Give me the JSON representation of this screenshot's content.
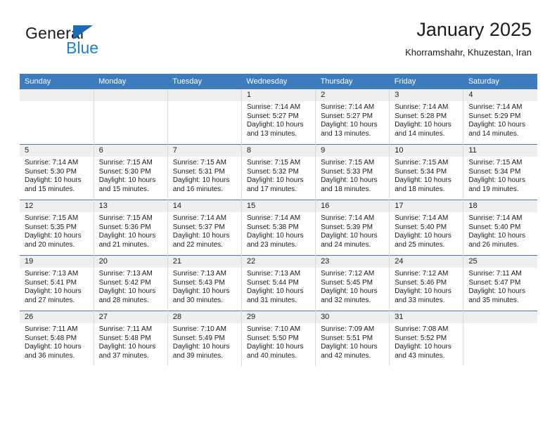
{
  "brand": {
    "name_part1": "General",
    "name_part2": "Blue",
    "triangle_color": "#1b6cb5",
    "blue_color": "#1b7fd4"
  },
  "header": {
    "title": "January 2025",
    "subtitle": "Khorramshahr, Khuzestan, Iran",
    "header_bg": "#3d7cbf",
    "daynum_bg": "#efefef"
  },
  "weekday_headers": [
    "Sunday",
    "Monday",
    "Tuesday",
    "Wednesday",
    "Thursday",
    "Friday",
    "Saturday"
  ],
  "labels": {
    "sunrise_prefix": "Sunrise:",
    "sunset_prefix": "Sunset:",
    "daylight_prefix": "Daylight:"
  },
  "weeks": [
    [
      {
        "empty": true
      },
      {
        "empty": true
      },
      {
        "empty": true
      },
      {
        "day": "1",
        "sunrise": "Sunrise: 7:14 AM",
        "sunset": "Sunset: 5:27 PM",
        "daylight_line1": "Daylight: 10 hours",
        "daylight_line2": "and 13 minutes."
      },
      {
        "day": "2",
        "sunrise": "Sunrise: 7:14 AM",
        "sunset": "Sunset: 5:27 PM",
        "daylight_line1": "Daylight: 10 hours",
        "daylight_line2": "and 13 minutes."
      },
      {
        "day": "3",
        "sunrise": "Sunrise: 7:14 AM",
        "sunset": "Sunset: 5:28 PM",
        "daylight_line1": "Daylight: 10 hours",
        "daylight_line2": "and 14 minutes."
      },
      {
        "day": "4",
        "sunrise": "Sunrise: 7:14 AM",
        "sunset": "Sunset: 5:29 PM",
        "daylight_line1": "Daylight: 10 hours",
        "daylight_line2": "and 14 minutes."
      }
    ],
    [
      {
        "day": "5",
        "sunrise": "Sunrise: 7:14 AM",
        "sunset": "Sunset: 5:30 PM",
        "daylight_line1": "Daylight: 10 hours",
        "daylight_line2": "and 15 minutes."
      },
      {
        "day": "6",
        "sunrise": "Sunrise: 7:15 AM",
        "sunset": "Sunset: 5:30 PM",
        "daylight_line1": "Daylight: 10 hours",
        "daylight_line2": "and 15 minutes."
      },
      {
        "day": "7",
        "sunrise": "Sunrise: 7:15 AM",
        "sunset": "Sunset: 5:31 PM",
        "daylight_line1": "Daylight: 10 hours",
        "daylight_line2": "and 16 minutes."
      },
      {
        "day": "8",
        "sunrise": "Sunrise: 7:15 AM",
        "sunset": "Sunset: 5:32 PM",
        "daylight_line1": "Daylight: 10 hours",
        "daylight_line2": "and 17 minutes."
      },
      {
        "day": "9",
        "sunrise": "Sunrise: 7:15 AM",
        "sunset": "Sunset: 5:33 PM",
        "daylight_line1": "Daylight: 10 hours",
        "daylight_line2": "and 18 minutes."
      },
      {
        "day": "10",
        "sunrise": "Sunrise: 7:15 AM",
        "sunset": "Sunset: 5:34 PM",
        "daylight_line1": "Daylight: 10 hours",
        "daylight_line2": "and 18 minutes."
      },
      {
        "day": "11",
        "sunrise": "Sunrise: 7:15 AM",
        "sunset": "Sunset: 5:34 PM",
        "daylight_line1": "Daylight: 10 hours",
        "daylight_line2": "and 19 minutes."
      }
    ],
    [
      {
        "day": "12",
        "sunrise": "Sunrise: 7:15 AM",
        "sunset": "Sunset: 5:35 PM",
        "daylight_line1": "Daylight: 10 hours",
        "daylight_line2": "and 20 minutes."
      },
      {
        "day": "13",
        "sunrise": "Sunrise: 7:15 AM",
        "sunset": "Sunset: 5:36 PM",
        "daylight_line1": "Daylight: 10 hours",
        "daylight_line2": "and 21 minutes."
      },
      {
        "day": "14",
        "sunrise": "Sunrise: 7:14 AM",
        "sunset": "Sunset: 5:37 PM",
        "daylight_line1": "Daylight: 10 hours",
        "daylight_line2": "and 22 minutes."
      },
      {
        "day": "15",
        "sunrise": "Sunrise: 7:14 AM",
        "sunset": "Sunset: 5:38 PM",
        "daylight_line1": "Daylight: 10 hours",
        "daylight_line2": "and 23 minutes."
      },
      {
        "day": "16",
        "sunrise": "Sunrise: 7:14 AM",
        "sunset": "Sunset: 5:39 PM",
        "daylight_line1": "Daylight: 10 hours",
        "daylight_line2": "and 24 minutes."
      },
      {
        "day": "17",
        "sunrise": "Sunrise: 7:14 AM",
        "sunset": "Sunset: 5:40 PM",
        "daylight_line1": "Daylight: 10 hours",
        "daylight_line2": "and 25 minutes."
      },
      {
        "day": "18",
        "sunrise": "Sunrise: 7:14 AM",
        "sunset": "Sunset: 5:40 PM",
        "daylight_line1": "Daylight: 10 hours",
        "daylight_line2": "and 26 minutes."
      }
    ],
    [
      {
        "day": "19",
        "sunrise": "Sunrise: 7:13 AM",
        "sunset": "Sunset: 5:41 PM",
        "daylight_line1": "Daylight: 10 hours",
        "daylight_line2": "and 27 minutes."
      },
      {
        "day": "20",
        "sunrise": "Sunrise: 7:13 AM",
        "sunset": "Sunset: 5:42 PM",
        "daylight_line1": "Daylight: 10 hours",
        "daylight_line2": "and 28 minutes."
      },
      {
        "day": "21",
        "sunrise": "Sunrise: 7:13 AM",
        "sunset": "Sunset: 5:43 PM",
        "daylight_line1": "Daylight: 10 hours",
        "daylight_line2": "and 30 minutes."
      },
      {
        "day": "22",
        "sunrise": "Sunrise: 7:13 AM",
        "sunset": "Sunset: 5:44 PM",
        "daylight_line1": "Daylight: 10 hours",
        "daylight_line2": "and 31 minutes."
      },
      {
        "day": "23",
        "sunrise": "Sunrise: 7:12 AM",
        "sunset": "Sunset: 5:45 PM",
        "daylight_line1": "Daylight: 10 hours",
        "daylight_line2": "and 32 minutes."
      },
      {
        "day": "24",
        "sunrise": "Sunrise: 7:12 AM",
        "sunset": "Sunset: 5:46 PM",
        "daylight_line1": "Daylight: 10 hours",
        "daylight_line2": "and 33 minutes."
      },
      {
        "day": "25",
        "sunrise": "Sunrise: 7:11 AM",
        "sunset": "Sunset: 5:47 PM",
        "daylight_line1": "Daylight: 10 hours",
        "daylight_line2": "and 35 minutes."
      }
    ],
    [
      {
        "day": "26",
        "sunrise": "Sunrise: 7:11 AM",
        "sunset": "Sunset: 5:48 PM",
        "daylight_line1": "Daylight: 10 hours",
        "daylight_line2": "and 36 minutes."
      },
      {
        "day": "27",
        "sunrise": "Sunrise: 7:11 AM",
        "sunset": "Sunset: 5:48 PM",
        "daylight_line1": "Daylight: 10 hours",
        "daylight_line2": "and 37 minutes."
      },
      {
        "day": "28",
        "sunrise": "Sunrise: 7:10 AM",
        "sunset": "Sunset: 5:49 PM",
        "daylight_line1": "Daylight: 10 hours",
        "daylight_line2": "and 39 minutes."
      },
      {
        "day": "29",
        "sunrise": "Sunrise: 7:10 AM",
        "sunset": "Sunset: 5:50 PM",
        "daylight_line1": "Daylight: 10 hours",
        "daylight_line2": "and 40 minutes."
      },
      {
        "day": "30",
        "sunrise": "Sunrise: 7:09 AM",
        "sunset": "Sunset: 5:51 PM",
        "daylight_line1": "Daylight: 10 hours",
        "daylight_line2": "and 42 minutes."
      },
      {
        "day": "31",
        "sunrise": "Sunrise: 7:08 AM",
        "sunset": "Sunset: 5:52 PM",
        "daylight_line1": "Daylight: 10 hours",
        "daylight_line2": "and 43 minutes."
      },
      {
        "empty": true
      }
    ]
  ]
}
